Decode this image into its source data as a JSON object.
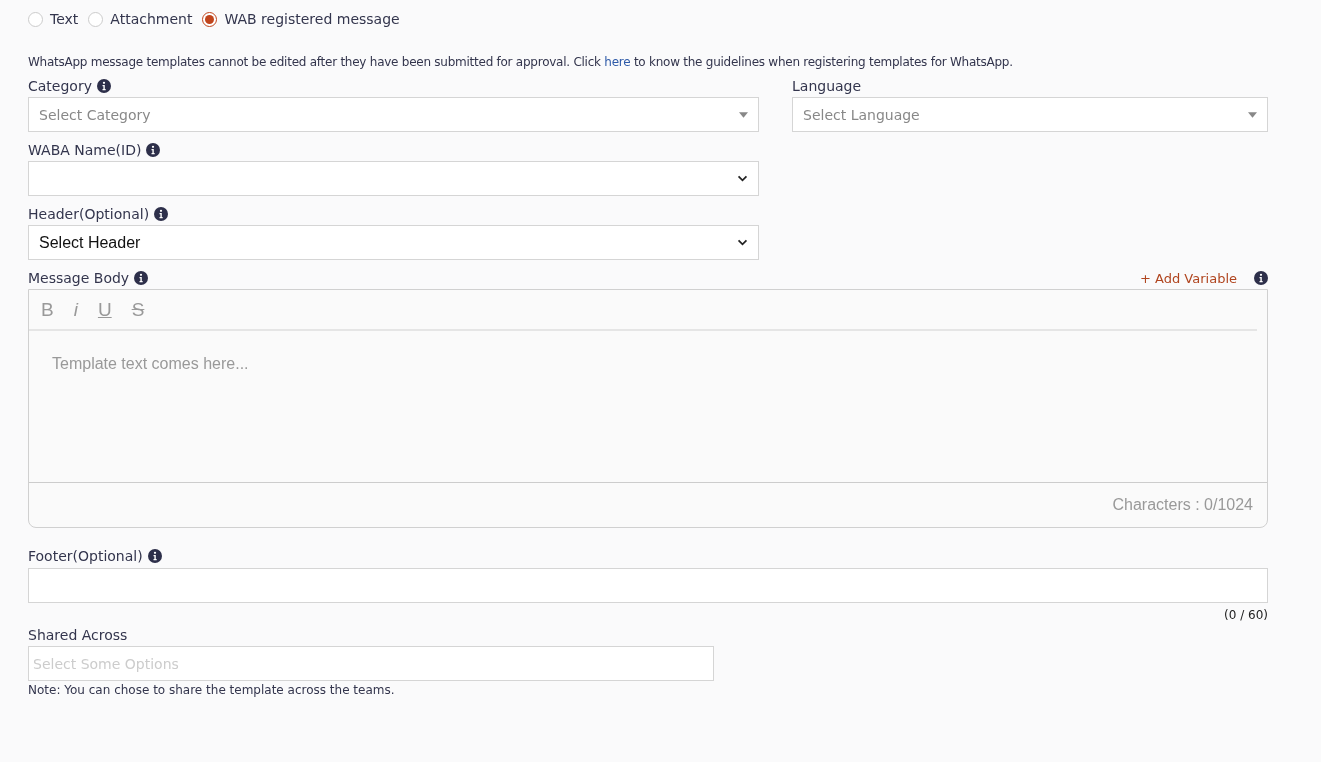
{
  "message_types": [
    {
      "label": "Text",
      "selected": false
    },
    {
      "label": "Attachment",
      "selected": false
    },
    {
      "label": "WAB registered message",
      "selected": true
    }
  ],
  "notice": {
    "before": "WhatsApp message templates cannot be edited after they have been submitted for approval. Click",
    "link": "here",
    "after": "to know the guidelines when registering templates for WhatsApp."
  },
  "category": {
    "label": "Category",
    "placeholder": "Select Category"
  },
  "language": {
    "label": "Language",
    "placeholder": "Select Language"
  },
  "waba_name": {
    "label": "WABA Name(ID)"
  },
  "header": {
    "label": "Header(Optional)",
    "value": "Select Header"
  },
  "message_body": {
    "label": "Message Body",
    "add_variable": "+ Add Variable",
    "toolbar": [
      {
        "kind": "bold",
        "label": "B"
      },
      {
        "kind": "italic",
        "label": "i"
      },
      {
        "kind": "underline",
        "label": "U"
      },
      {
        "kind": "strike",
        "label": "S"
      }
    ],
    "placeholder": "Template text comes here...",
    "counter": "Characters : 0/1024"
  },
  "footer": {
    "label": "Footer(Optional)",
    "counter": "(0 / 60)"
  },
  "shared_across": {
    "label": "Shared Across",
    "placeholder": "Select Some Options",
    "note": "Note: You can chose to share the template across the teams."
  }
}
